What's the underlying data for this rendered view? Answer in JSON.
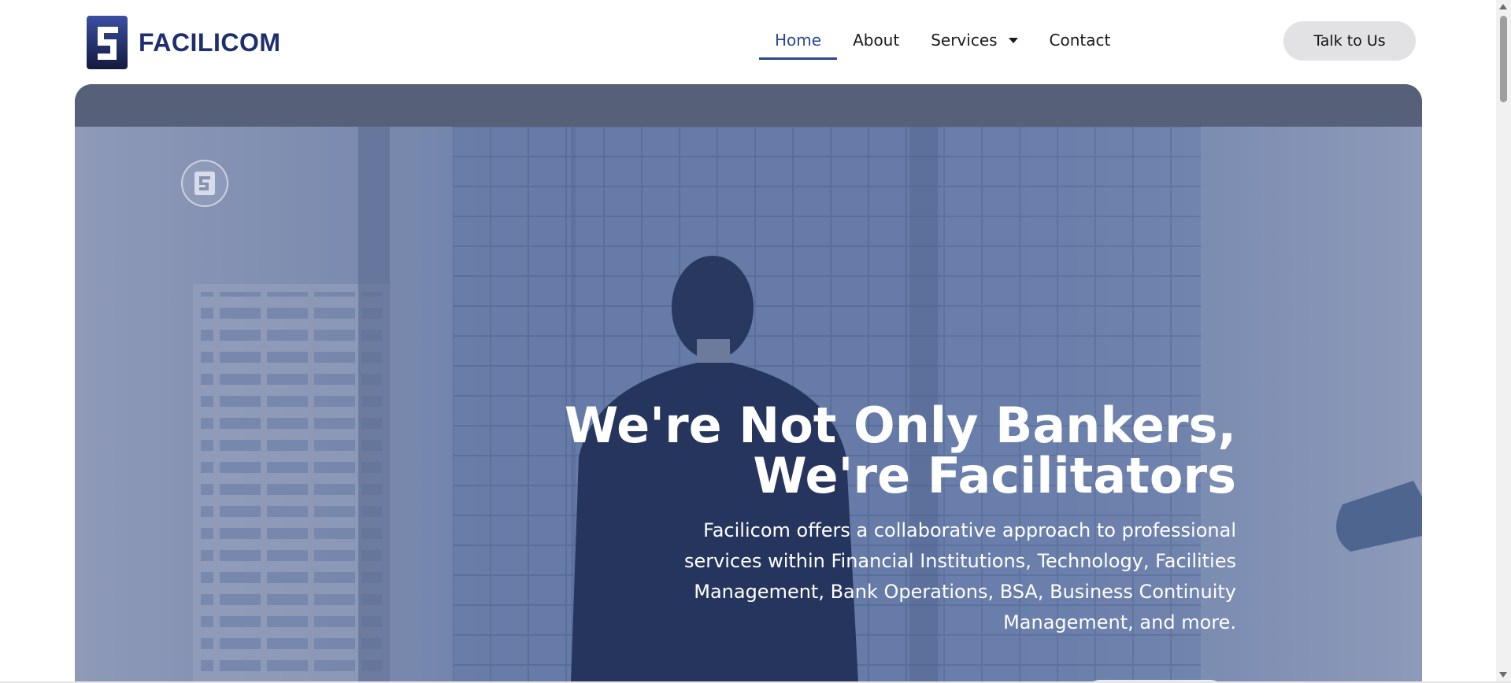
{
  "brand": {
    "name": "FACILICOM",
    "accent_color": "#2a4694",
    "text_color": "#1f2f6e"
  },
  "nav": {
    "items": [
      {
        "label": "Home",
        "active": true
      },
      {
        "label": "About",
        "active": false
      },
      {
        "label": "Services",
        "active": false,
        "has_dropdown": true
      },
      {
        "label": "Contact",
        "active": false
      }
    ]
  },
  "cta": {
    "label": "Talk to Us"
  },
  "hero": {
    "title_line1": "We're Not Only Bankers,",
    "title_line2": "We're Facilitators",
    "description": "Facilicom offers a collaborative approach to professional services within Financial Institutions, Technology, Facilities Management, Bank Operations, BSA, Business Continuity Management, and more.",
    "overlay_color": "#566079"
  },
  "icons": [
    "logo-mark-icon",
    "chevron-down-icon",
    "logo-badge-icon",
    "scroll-up-icon",
    "scroll-down-icon"
  ]
}
